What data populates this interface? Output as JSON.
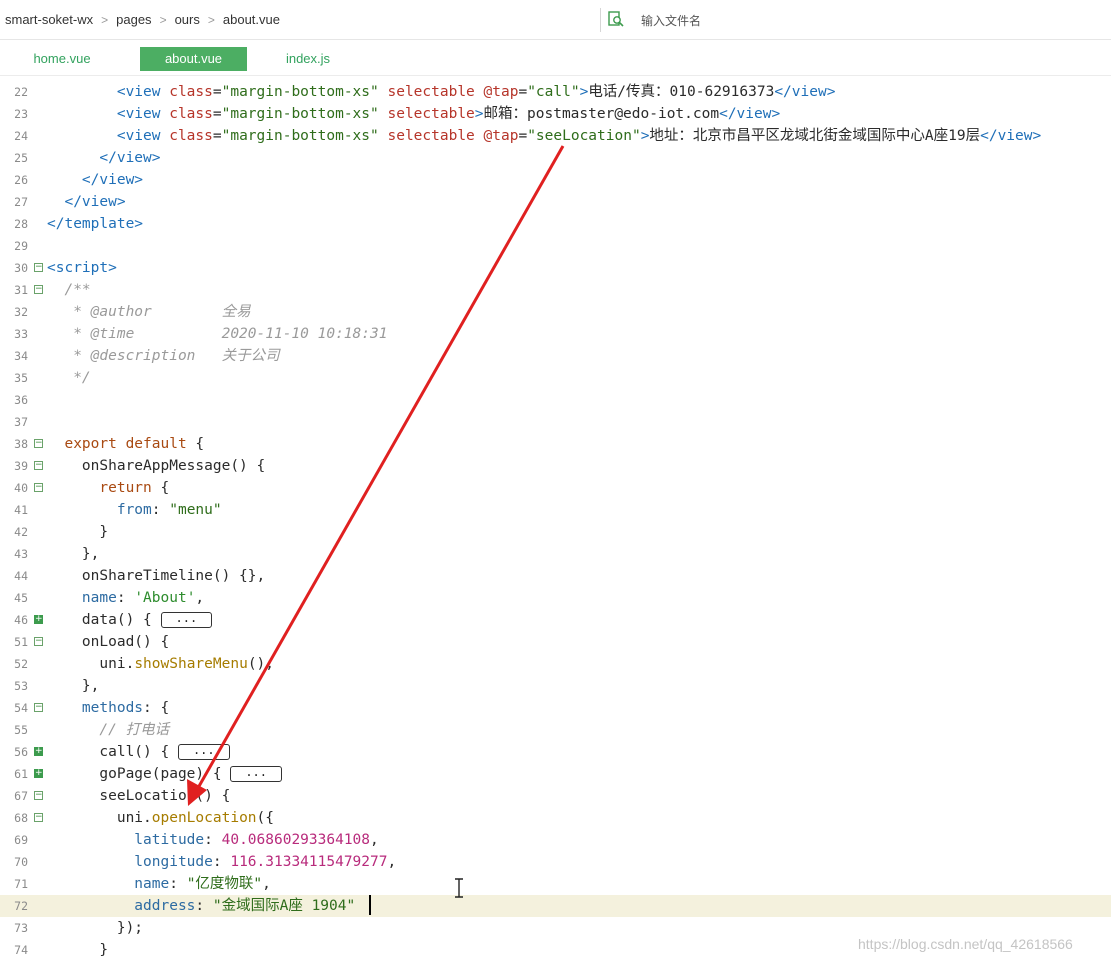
{
  "breadcrumb": [
    "smart-soket-wx",
    "pages",
    "ours",
    "about.vue"
  ],
  "search": {
    "placeholder": "输入文件名"
  },
  "tabs": [
    {
      "label": "home.vue",
      "active": false
    },
    {
      "label": "about.vue",
      "active": true
    },
    {
      "label": "index.js",
      "active": false
    }
  ],
  "colors": {
    "accent": "#4cae63",
    "arrow": "#e02020",
    "tab_text": "#32a25e"
  },
  "lines": [
    {
      "n": "22",
      "fold": "",
      "parts": [
        [
          "tag",
          "        <view "
        ],
        [
          "attr",
          "class"
        ],
        [
          "plain",
          "="
        ],
        [
          "str",
          "\"margin-bottom-xs\""
        ],
        [
          "plain",
          " "
        ],
        [
          "attr",
          "selectable"
        ],
        [
          "plain",
          " "
        ],
        [
          "attr",
          "@tap"
        ],
        [
          "plain",
          "="
        ],
        [
          "str",
          "\"call\""
        ],
        [
          "tag",
          ">"
        ],
        [
          "plain",
          "电话/传真：010-62916373"
        ],
        [
          "tag",
          "</view>"
        ]
      ]
    },
    {
      "n": "23",
      "fold": "",
      "parts": [
        [
          "tag",
          "        <view "
        ],
        [
          "attr",
          "class"
        ],
        [
          "plain",
          "="
        ],
        [
          "str",
          "\"margin-bottom-xs\""
        ],
        [
          "plain",
          " "
        ],
        [
          "attr",
          "selectable"
        ],
        [
          "tag",
          ">"
        ],
        [
          "plain",
          "邮箱：postmaster@edo-iot.com"
        ],
        [
          "tag",
          "</view>"
        ]
      ]
    },
    {
      "n": "24",
      "fold": "",
      "parts": [
        [
          "tag",
          "        <view "
        ],
        [
          "attr",
          "class"
        ],
        [
          "plain",
          "="
        ],
        [
          "str",
          "\"margin-bottom-xs\""
        ],
        [
          "plain",
          " "
        ],
        [
          "attr",
          "selectable"
        ],
        [
          "plain",
          " "
        ],
        [
          "attr",
          "@tap"
        ],
        [
          "plain",
          "="
        ],
        [
          "str",
          "\"seeLocation\""
        ],
        [
          "tag",
          ">"
        ],
        [
          "plain",
          "地址：北京市昌平区龙域北街金域国际中心A座19层"
        ],
        [
          "tag",
          "</view>"
        ]
      ]
    },
    {
      "n": "25",
      "fold": "",
      "parts": [
        [
          "tag",
          "      </view>"
        ]
      ]
    },
    {
      "n": "26",
      "fold": "",
      "parts": [
        [
          "tag",
          "    </view>"
        ]
      ]
    },
    {
      "n": "27",
      "fold": "",
      "parts": [
        [
          "tag",
          "  </view>"
        ]
      ]
    },
    {
      "n": "28",
      "fold": "",
      "parts": [
        [
          "tag",
          "</template>"
        ]
      ]
    },
    {
      "n": "29",
      "fold": "",
      "parts": []
    },
    {
      "n": "30",
      "fold": "open",
      "parts": [
        [
          "tag",
          "<script>"
        ]
      ]
    },
    {
      "n": "31",
      "fold": "open",
      "parts": [
        [
          "cmt",
          "  /**"
        ]
      ]
    },
    {
      "n": "32",
      "fold": "",
      "parts": [
        [
          "cmt",
          "   * @author        全易"
        ]
      ]
    },
    {
      "n": "33",
      "fold": "",
      "parts": [
        [
          "cmt",
          "   * @time          2020-11-10 10:18:31"
        ]
      ]
    },
    {
      "n": "34",
      "fold": "",
      "parts": [
        [
          "cmt",
          "   * @description   关于公司"
        ]
      ]
    },
    {
      "n": "35",
      "fold": "",
      "parts": [
        [
          "cmt",
          "   */"
        ]
      ]
    },
    {
      "n": "36",
      "fold": "",
      "parts": []
    },
    {
      "n": "37",
      "fold": "",
      "parts": []
    },
    {
      "n": "38",
      "fold": "open",
      "parts": [
        [
          "kw",
          "  export default"
        ],
        [
          "plain",
          " {"
        ]
      ]
    },
    {
      "n": "39",
      "fold": "open",
      "parts": [
        [
          "plain",
          "    onShareAppMessage() {"
        ]
      ]
    },
    {
      "n": "40",
      "fold": "open",
      "parts": [
        [
          "kw",
          "      return"
        ],
        [
          "plain",
          " {"
        ]
      ]
    },
    {
      "n": "41",
      "fold": "",
      "parts": [
        [
          "prop",
          "        from"
        ],
        [
          "plain",
          ": "
        ],
        [
          "str",
          "\"menu\""
        ]
      ]
    },
    {
      "n": "42",
      "fold": "",
      "parts": [
        [
          "plain",
          "      }"
        ]
      ]
    },
    {
      "n": "43",
      "fold": "",
      "parts": [
        [
          "plain",
          "    },"
        ]
      ]
    },
    {
      "n": "44",
      "fold": "",
      "parts": [
        [
          "plain",
          "    onShareTimeline() {},"
        ]
      ]
    },
    {
      "n": "45",
      "fold": "",
      "parts": [
        [
          "prop",
          "    name"
        ],
        [
          "plain",
          ": "
        ],
        [
          "str2",
          "'About'"
        ],
        [
          "plain",
          ","
        ]
      ]
    },
    {
      "n": "46",
      "fold": "closed",
      "parts": [
        [
          "plain",
          "    data() { "
        ],
        [
          "fold",
          "..."
        ]
      ]
    },
    {
      "n": "51",
      "fold": "open",
      "parts": [
        [
          "plain",
          "    onLoad() {"
        ]
      ]
    },
    {
      "n": "52",
      "fold": "",
      "parts": [
        [
          "plain",
          "      uni."
        ],
        [
          "fn",
          "showShareMenu"
        ],
        [
          "plain",
          "();"
        ]
      ]
    },
    {
      "n": "53",
      "fold": "",
      "parts": [
        [
          "plain",
          "    },"
        ]
      ]
    },
    {
      "n": "54",
      "fold": "open",
      "parts": [
        [
          "prop",
          "    methods"
        ],
        [
          "plain",
          ": {"
        ]
      ]
    },
    {
      "n": "55",
      "fold": "",
      "parts": [
        [
          "cmt",
          "      // 打电话"
        ]
      ]
    },
    {
      "n": "56",
      "fold": "closed",
      "parts": [
        [
          "plain",
          "      call() { "
        ],
        [
          "fold",
          "..."
        ]
      ]
    },
    {
      "n": "61",
      "fold": "closed",
      "parts": [
        [
          "plain",
          "      goPage(page) { "
        ],
        [
          "fold",
          "..."
        ]
      ]
    },
    {
      "n": "67",
      "fold": "open",
      "parts": [
        [
          "plain",
          "      seeLocation() {"
        ]
      ]
    },
    {
      "n": "68",
      "fold": "open",
      "parts": [
        [
          "plain",
          "        uni."
        ],
        [
          "fn",
          "openLocation"
        ],
        [
          "plain",
          "({"
        ]
      ]
    },
    {
      "n": "69",
      "fold": "",
      "parts": [
        [
          "prop",
          "          latitude"
        ],
        [
          "plain",
          ": "
        ],
        [
          "num",
          "40.06860293364108"
        ],
        [
          "plain",
          ","
        ]
      ]
    },
    {
      "n": "70",
      "fold": "",
      "parts": [
        [
          "prop",
          "          longitude"
        ],
        [
          "plain",
          ": "
        ],
        [
          "num",
          "116.31334115479277"
        ],
        [
          "plain",
          ","
        ]
      ]
    },
    {
      "n": "71",
      "fold": "",
      "parts": [
        [
          "prop",
          "          name"
        ],
        [
          "plain",
          ": "
        ],
        [
          "str",
          "\"亿度物联\""
        ],
        [
          "plain",
          ","
        ]
      ]
    },
    {
      "n": "72",
      "fold": "",
      "current": true,
      "parts": [
        [
          "prop",
          "          address"
        ],
        [
          "plain",
          ": "
        ],
        [
          "str",
          "\"金域国际A座 1904\""
        ]
      ]
    },
    {
      "n": "73",
      "fold": "",
      "parts": [
        [
          "plain",
          "        });"
        ]
      ]
    },
    {
      "n": "74",
      "fold": "",
      "parts": [
        [
          "plain",
          "      }"
        ]
      ]
    }
  ],
  "watermark": "https://blog.csdn.net/qq_42618566"
}
